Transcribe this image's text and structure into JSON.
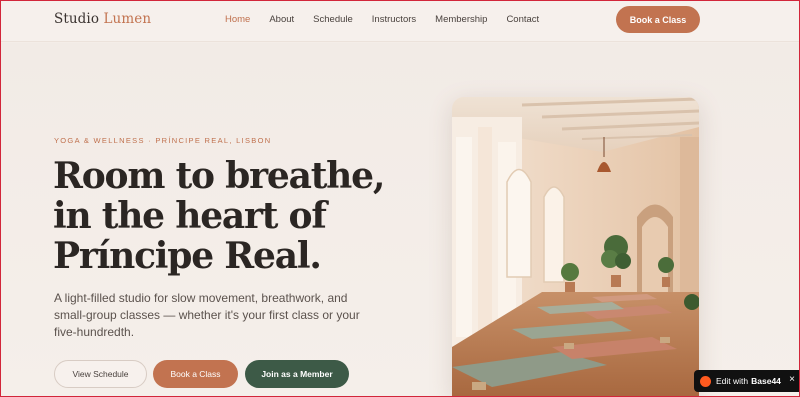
{
  "header": {
    "logo": {
      "part1": "Studio",
      "part2": "Lumen"
    },
    "nav": [
      "Home",
      "About",
      "Schedule",
      "Instructors",
      "Membership",
      "Contact"
    ],
    "active_nav": "Home",
    "cta": "Book a Class"
  },
  "hero": {
    "eyebrow": "YOGA & WELLNESS · PRÍNCIPE REAL, LISBON",
    "headline": [
      "Room to breathe,",
      "in the heart of",
      "Príncipe Real."
    ],
    "description": "A light-filled studio for slow movement, breathwork, and small-group classes — whether it's your first class or your five-hundredth.",
    "buttons": {
      "view_schedule": "View Schedule",
      "book_class": "Book a Class",
      "join_member": "Join as a Member"
    },
    "photo_icon": "yoga-studio-photo"
  },
  "badge": {
    "prefix": "Edit with",
    "brand": "Base44",
    "close": "×"
  },
  "colors": {
    "accent": "#c27350",
    "green": "#3d5a47",
    "background": "#f4ede8",
    "text": "#2b2623"
  }
}
